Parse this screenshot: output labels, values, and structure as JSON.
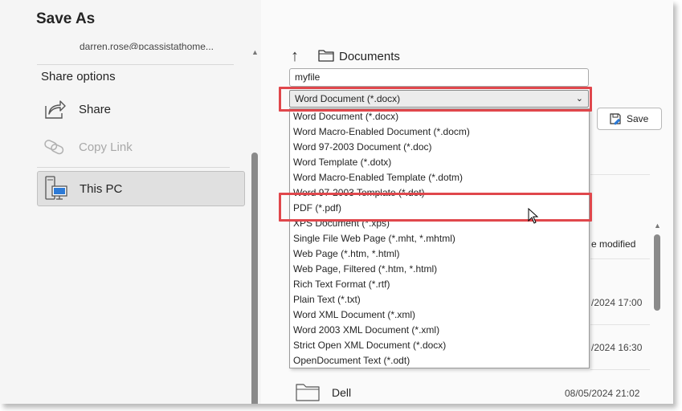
{
  "dialog": {
    "title": "Save As"
  },
  "left_pane": {
    "account": "darren.rose@pcassistathome...",
    "share_heading": "Share options",
    "items": [
      {
        "label": "Share",
        "icon": "share-icon",
        "enabled": true
      },
      {
        "label": "Copy Link",
        "icon": "copy-link-icon",
        "enabled": false
      },
      {
        "label": "This PC",
        "icon": "this-pc-icon",
        "selected": true
      }
    ]
  },
  "location": {
    "folder": "Documents"
  },
  "file_name": {
    "value": "myfile"
  },
  "file_type": {
    "selected": "Word Document (*.docx)",
    "options": [
      "Word Document (*.docx)",
      "Word Macro-Enabled Document (*.docm)",
      "Word 97-2003 Document (*.doc)",
      "Word Template (*.dotx)",
      "Word Macro-Enabled Template (*.dotm)",
      "Word 97-2003 Template (*.dot)",
      "PDF (*.pdf)",
      "XPS Document (*.xps)",
      "Single File Web Page (*.mht, *.mhtml)",
      "Web Page (*.htm, *.html)",
      "Web Page, Filtered (*.htm, *.html)",
      "Rich Text Format (*.rtf)",
      "Plain Text (*.txt)",
      "Word XML Document (*.xml)",
      "Word 2003 XML Document (*.xml)",
      "Strict Open XML Document (*.docx)",
      "OpenDocument Text (*.odt)"
    ]
  },
  "actions": {
    "save": "Save"
  },
  "file_list": {
    "column_modified": "e modified",
    "rows": [
      {
        "date": "/2024 17:00"
      },
      {
        "date": "/2024 16:30"
      },
      {
        "name": "Dell",
        "date": "08/05/2024 21:02"
      }
    ]
  },
  "colors": {
    "highlight": "#e0474c",
    "selected_bg": "#e0e0e0"
  }
}
